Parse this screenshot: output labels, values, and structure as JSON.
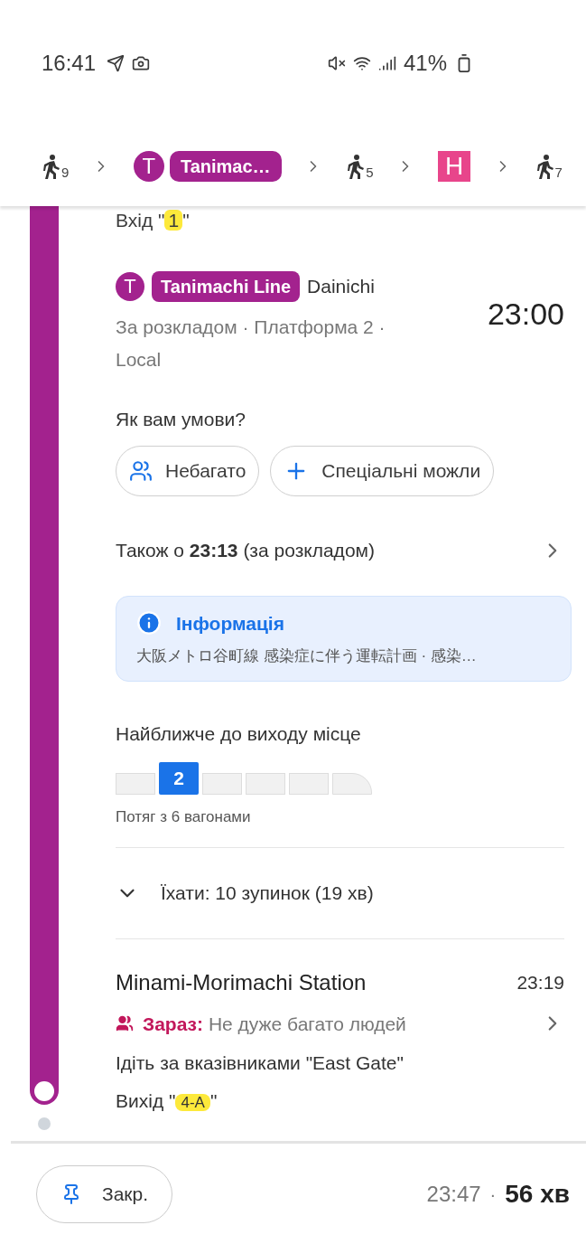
{
  "status_bar": {
    "time": "16:41",
    "battery": "41%"
  },
  "route_summary": [
    {
      "kind": "walk",
      "minutes": "9"
    },
    {
      "kind": "line",
      "icon": "T",
      "name": "Tanimac…",
      "color": "#a3228e"
    },
    {
      "kind": "walk",
      "minutes": "5"
    },
    {
      "kind": "square",
      "icon": "H",
      "color": "#e8458b"
    },
    {
      "kind": "walk",
      "minutes": "7"
    }
  ],
  "entrance": {
    "prefix": "Вхід \"",
    "code": "1",
    "suffix": "\""
  },
  "departure": {
    "icon": "T",
    "line": "Tanimachi Line",
    "direction": "Dainichi",
    "details": "За розкладом · Платформа 2 · Local",
    "time": "23:00"
  },
  "feedback": {
    "question": "Як вам умови?",
    "chips": [
      {
        "kind": "crowd",
        "label": "Небагато"
      },
      {
        "kind": "add",
        "label": "Спеціальні можли"
      }
    ]
  },
  "also": "Також о **23:13** (за розкладом)",
  "info": {
    "title": "Інформація",
    "text": "大阪メトロ谷町線 感染症に伴う運転計画 · 感染…"
  },
  "car_position": {
    "title": "Найближче до виходу місце",
    "cars": [
      {
        "selected": false
      },
      {
        "selected": true,
        "label": "2"
      },
      {
        "selected": false
      },
      {
        "selected": false
      },
      {
        "selected": false
      },
      {
        "selected": false
      }
    ],
    "caption": "Потяг з 6 вагонами"
  },
  "ride": {
    "label": "Їхати: 10 зупинок (19 хв)",
    "expanded": false
  },
  "arrival": {
    "station": "Minami-Morimachi Station",
    "time": "23:19",
    "crowd_label": "Зараз:",
    "crowd": "Не дуже багато людей",
    "directions": "Ідіть за вказівниками \"East Gate\"",
    "exit": {
      "prefix": "Вихід \"",
      "code": "4-A",
      "suffix": "\""
    }
  },
  "bottom_bar": {
    "pin_button": "Закр.",
    "arrival": "23:47",
    "separator": "·",
    "duration": "56 хв"
  }
}
